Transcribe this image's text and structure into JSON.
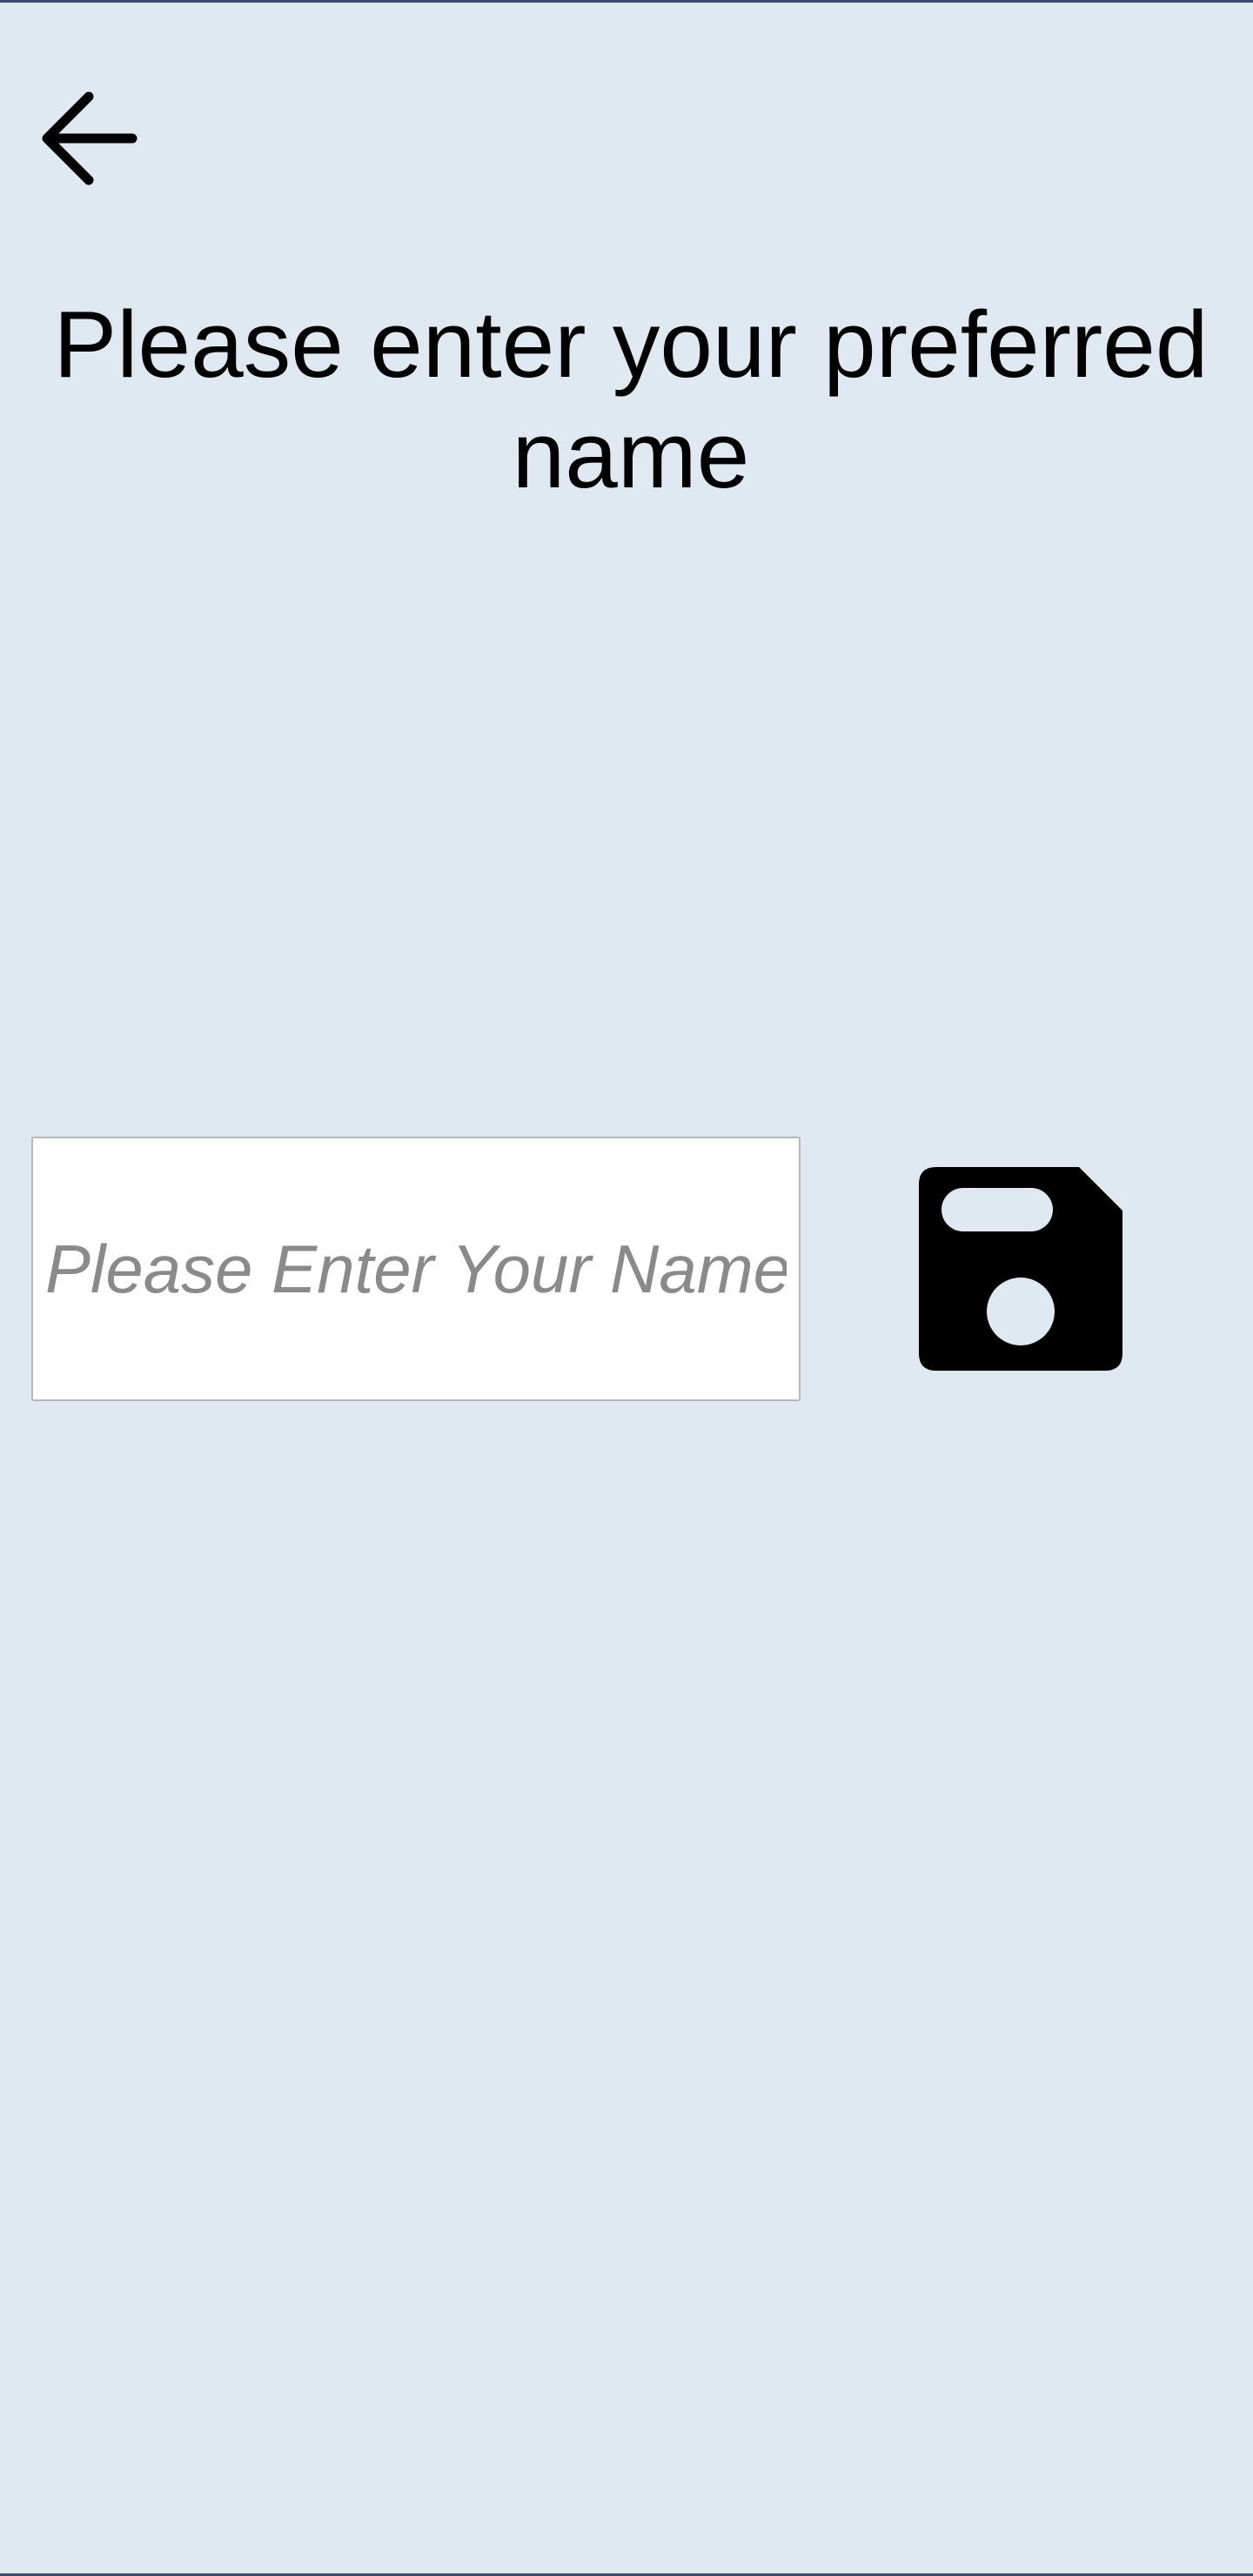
{
  "header": {
    "back_icon": "arrow-left-icon",
    "title": "Please enter your preferred name"
  },
  "form": {
    "name_input": {
      "value": "",
      "placeholder": "Please Enter Your Name"
    },
    "save_icon": "floppy-disk-save-icon"
  },
  "colors": {
    "background": "#e0e8f2",
    "border": "#3a4f6e",
    "icon": "#000000",
    "input_background": "#ffffff",
    "placeholder": "#8a8a8a"
  }
}
